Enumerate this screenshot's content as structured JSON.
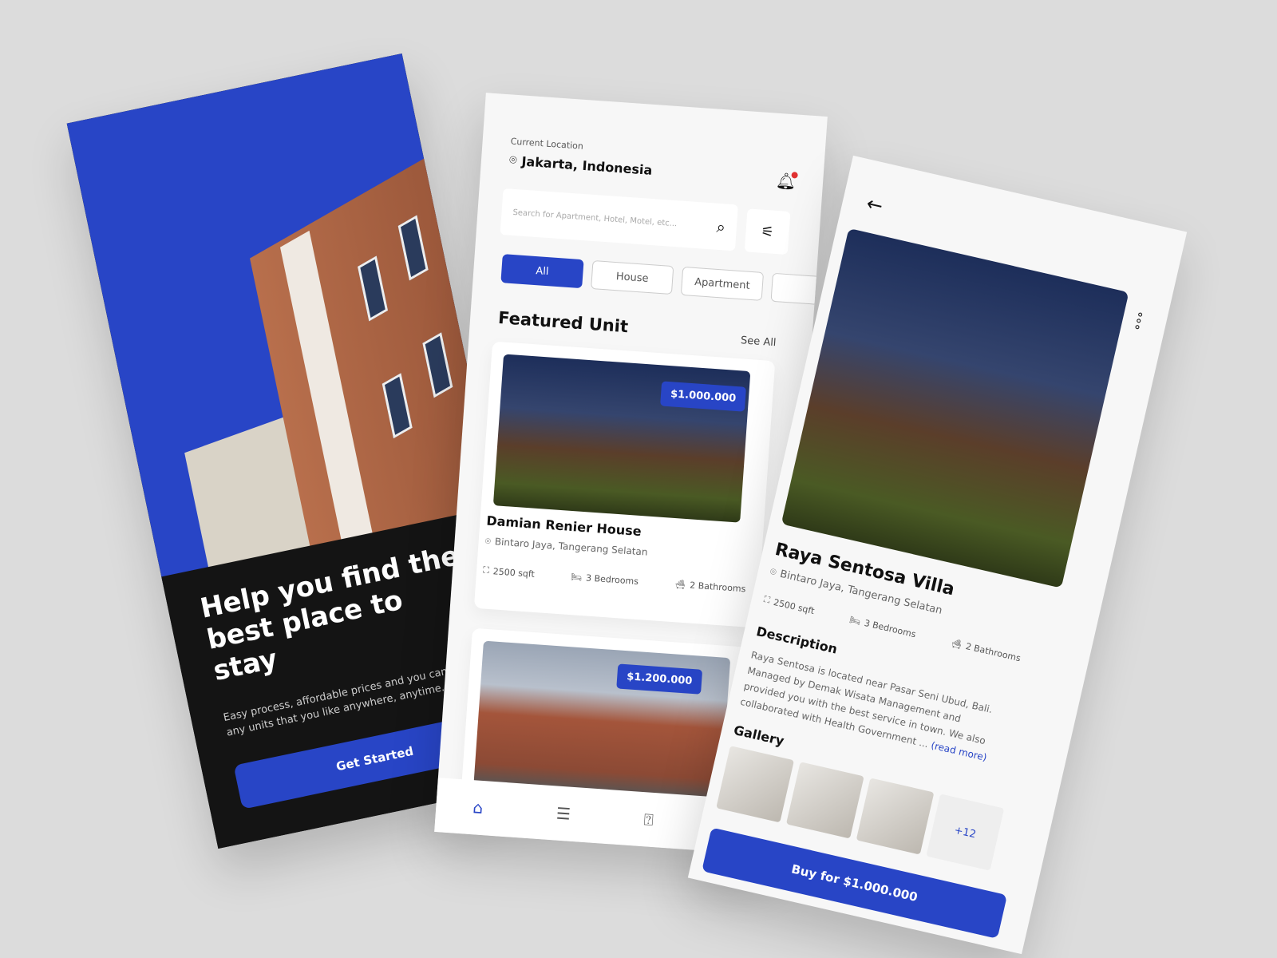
{
  "onboarding": {
    "headline": "Help you find the best place to stay",
    "subtitle": "Easy process, affordable prices and you can get any units that you like anywhere, anytime.",
    "button": "Get Started"
  },
  "home": {
    "location_label": "Current Location",
    "location": "Jakarta, Indonesia",
    "search_placeholder": "Search for Apartment, Hotel, Motel, etc...",
    "chips": [
      "All",
      "House",
      "Apartment"
    ],
    "section_title": "Featured Unit",
    "see_all": "See All",
    "units": [
      {
        "name": "Damian Renier House",
        "address": "Bintaro Jaya, Tangerang Selatan",
        "price": "$1.000.000",
        "area": "2500 sqft",
        "bedrooms": "3 Bedrooms",
        "bathrooms": "2 Bathrooms"
      },
      {
        "price": "$1.200.000"
      }
    ]
  },
  "detail": {
    "name": "Raya Sentosa Villa",
    "address": "Bintaro Jaya, Tangerang Selatan",
    "area": "2500 sqft",
    "bedrooms": "3 Bedrooms",
    "bathrooms": "2 Bathrooms",
    "description_title": "Description",
    "description": "Raya Sentosa is located near Pasar Seni Ubud, Bali. Managed by Demak Wisata Management and provided you with the best service in town. We also collaborated with Health Government ...",
    "read_more": "(read more)",
    "gallery_title": "Gallery",
    "gallery_more": "+12",
    "buy_button": "Buy for $1.000.000"
  },
  "colors": {
    "accent": "#2845c6",
    "background": "#dcdcdc",
    "dark": "#141414",
    "notification": "#e03030"
  }
}
